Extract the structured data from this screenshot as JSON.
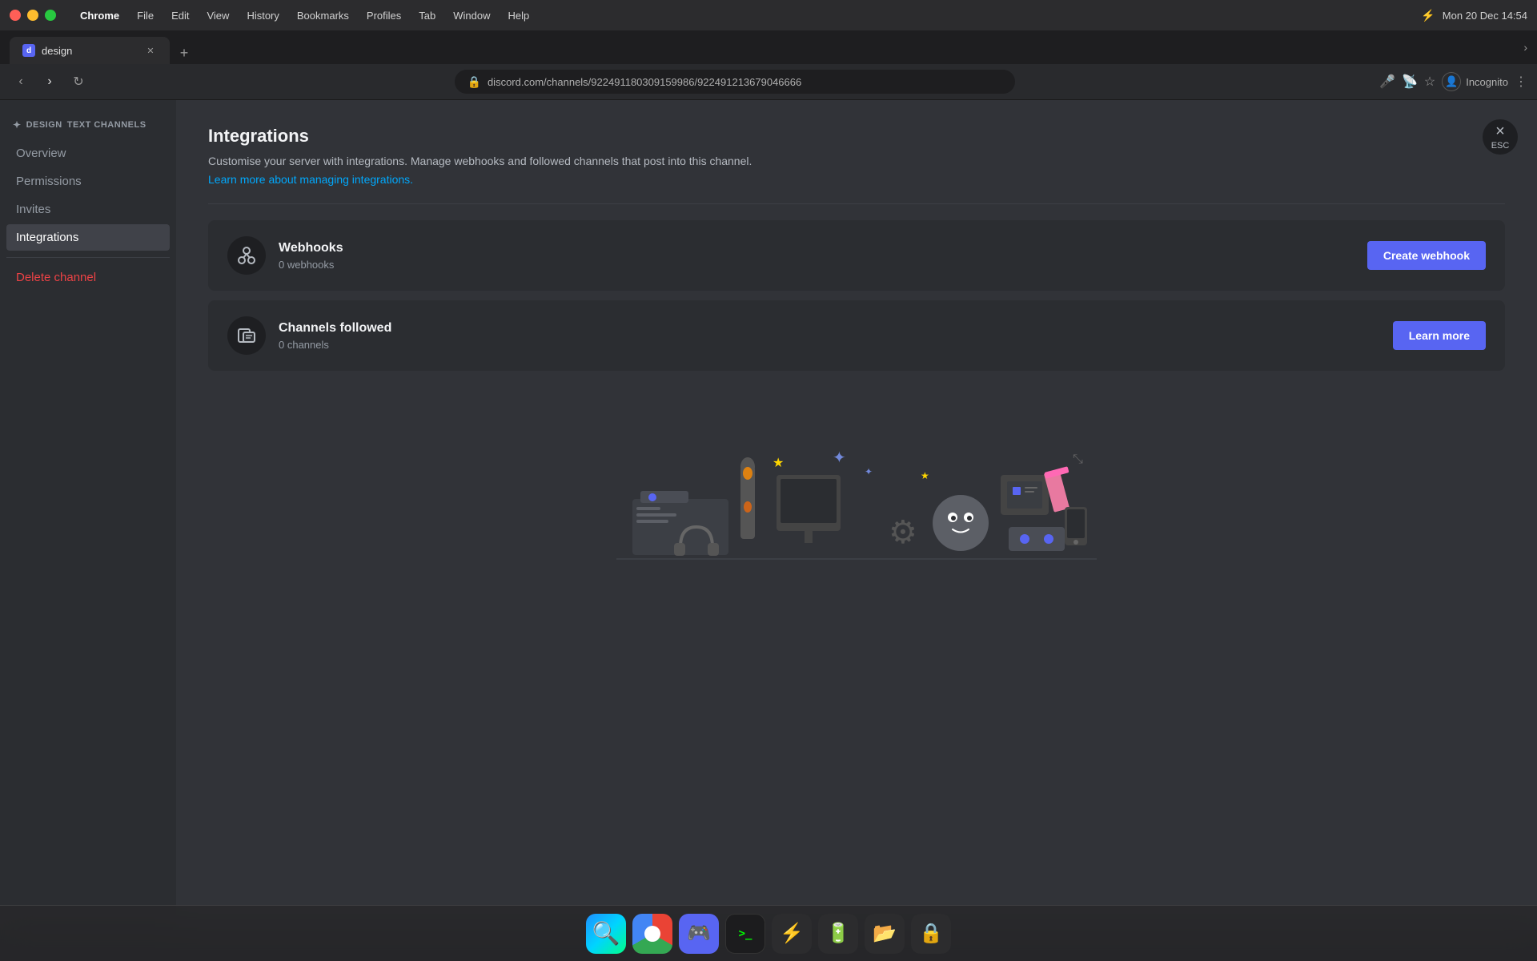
{
  "macos": {
    "titlebar": {
      "app_name": "Chrome",
      "menu_items": [
        "Chrome",
        "File",
        "Edit",
        "View",
        "History",
        "Bookmarks",
        "Profiles",
        "Tab",
        "Window",
        "Help"
      ],
      "time": "Mon 20 Dec  14:54"
    }
  },
  "browser": {
    "tab": {
      "title": "design",
      "url": "discord.com/channels/922491180309159986/922491213679046666"
    },
    "incognito": "Incognito"
  },
  "sidebar": {
    "header": {
      "icon": "✦",
      "server": "DESIGN",
      "channel": "TEXT CHANNELS"
    },
    "items": [
      {
        "label": "Overview",
        "active": false
      },
      {
        "label": "Permissions",
        "active": false
      },
      {
        "label": "Invites",
        "active": false
      },
      {
        "label": "Integrations",
        "active": true
      }
    ],
    "delete_label": "Delete channel"
  },
  "main": {
    "title": "Integrations",
    "description": "Customise your server with integrations. Manage webhooks and followed channels that post into this channel.",
    "link_text": "Learn more about managing integrations.",
    "close_label": "×",
    "esc_label": "ESC",
    "divider": true,
    "cards": [
      {
        "id": "webhooks",
        "name": "Webhooks",
        "count": "0 webhooks",
        "button_label": "Create webhook",
        "icon": "🔗"
      },
      {
        "id": "channels-followed",
        "name": "Channels followed",
        "count": "0 channels",
        "button_label": "Learn more",
        "icon": "📋"
      }
    ]
  },
  "dock": {
    "items": [
      {
        "id": "finder",
        "label": "Finder"
      },
      {
        "id": "chrome",
        "label": "Chrome"
      },
      {
        "id": "discord",
        "label": "Discord"
      },
      {
        "id": "terminal",
        "label": "Terminal"
      },
      {
        "id": "app1",
        "label": "App"
      }
    ]
  }
}
